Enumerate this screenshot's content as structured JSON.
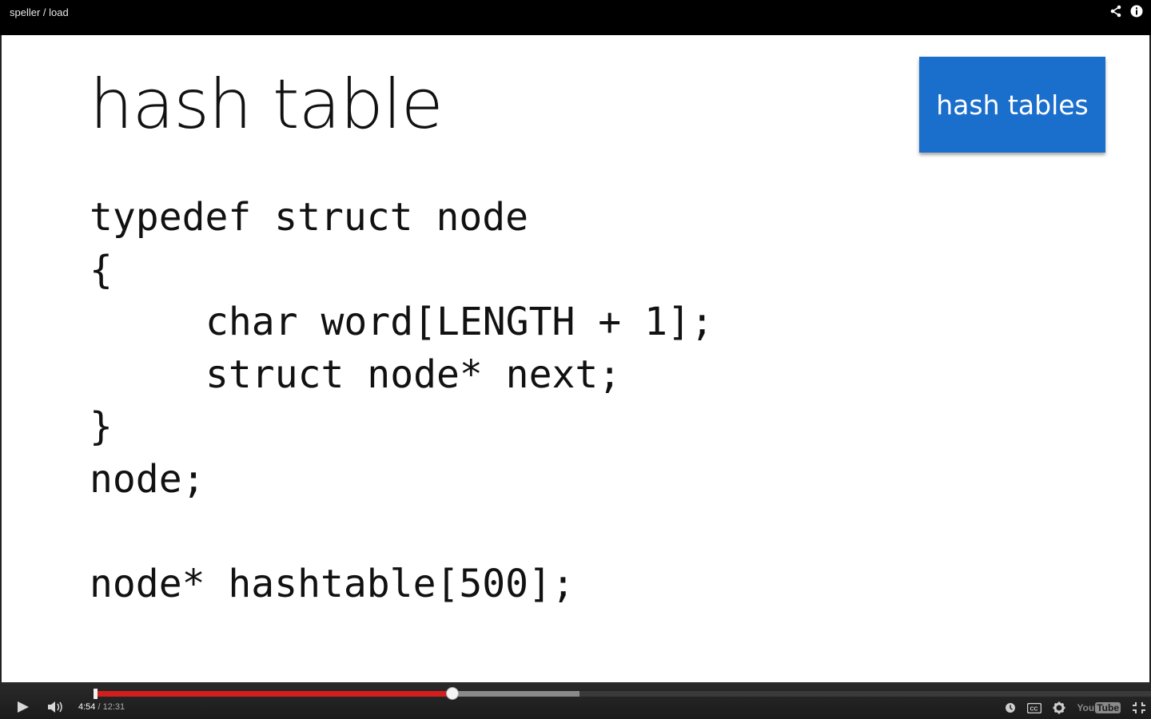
{
  "header": {
    "video_title": "speller / load",
    "icons": [
      "share-icon",
      "info-icon"
    ]
  },
  "slide": {
    "title": "hash table",
    "topic_badge": "hash tables",
    "code_lines": [
      "typedef struct node",
      "{",
      "char word[LENGTH + 1];",
      "struct node* next;",
      "}",
      "node;",
      "",
      "node* hashtable[500];"
    ]
  },
  "player": {
    "current_time": "4:54",
    "separator": "/",
    "duration": "12:31",
    "played_fraction": 0.3391,
    "buffered_fraction": 0.4592,
    "controls_left": [
      "play-icon",
      "volume-icon"
    ],
    "controls_right": [
      "watch-later-icon",
      "captions-icon",
      "settings-icon",
      "youtube-logo",
      "exit-fullscreen-icon"
    ],
    "logo_text_left": "You",
    "logo_text_right": "Tube",
    "accent_color": "#d41e1e",
    "badge_color": "#1b6fcc"
  }
}
